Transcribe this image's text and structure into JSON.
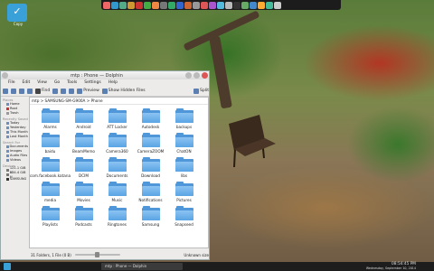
{
  "desktop": {
    "logo_label": "Copy"
  },
  "top_panel": {
    "icons": [
      "firefox",
      "thunderbird",
      "dolphin",
      "konsole",
      "okular",
      "chrome",
      "vlc",
      "gimp",
      "calc",
      "writer",
      "impress",
      "settings",
      "music",
      "photos",
      "mail",
      "ipod",
      "terminal",
      "network",
      "display",
      "weather",
      "maps",
      "search"
    ]
  },
  "window": {
    "title": "mtp : Phone — Dolphin",
    "menu": [
      "File",
      "Edit",
      "View",
      "Go",
      "Tools",
      "Settings",
      "Help"
    ],
    "toolbar": {
      "find": "Find",
      "preview": "Preview",
      "show_hidden": "Show Hidden Files",
      "split": "Split"
    },
    "breadcrumb": "mtp > SAMSUNG-SM-G900A > Phone",
    "sidebar": {
      "places_header": "Places",
      "places": [
        "Home",
        "Root",
        "Trash"
      ],
      "recent_header": "Recently Saved",
      "recent": [
        "Today",
        "Yesterday",
        "This Month",
        "Last Month"
      ],
      "search_header": "Search For",
      "search": [
        "Documents",
        "Images",
        "Audio Files",
        "Videos"
      ],
      "devices_header": "Devices",
      "devices": [
        "121.1 GiB H",
        "134.4 GiB H",
        "SAMSUNG"
      ]
    },
    "folders": [
      "Alarms",
      "Android",
      "ATT Locker",
      "Autodesk",
      "backups",
      "baidu",
      "BeamMemo",
      "Camera360",
      "CameraZOOM",
      "ChatON",
      "com.facebook.katana",
      "DCIM",
      "Documents",
      "Download",
      "libs",
      "media",
      "Movies",
      "Music",
      "Notifications",
      "Pictures",
      "Playlists",
      "Podcasts",
      "Ringtones",
      "Samsung",
      "Snapseed"
    ],
    "status": {
      "summary": "31 Folders, 1 File (0 B)",
      "free": "Unknown size",
      "zoom_fraction": 0.5
    }
  },
  "bottom_panel": {
    "task": "mtp : Phone — Dolphin",
    "time": "08:54:45 PM",
    "date": "Wednesday, September 10, 2014"
  }
}
